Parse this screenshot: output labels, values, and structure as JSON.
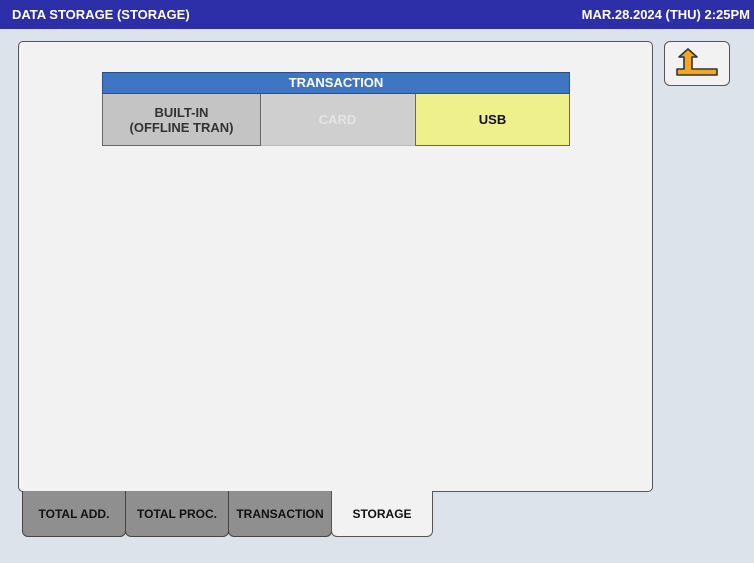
{
  "header": {
    "title": "DATA STORAGE (STORAGE)",
    "datetime": "MAR.28.2024 (THU)  2:25PM"
  },
  "back_button": {
    "icon": "return-arrow-icon"
  },
  "transaction_grid": {
    "header": "TRANSACTION",
    "options": {
      "builtin_line1": "BUILT-IN",
      "builtin_line2": "(OFFLINE TRAN)",
      "card": "CARD",
      "usb": "USB"
    },
    "selected": "USB",
    "colors": {
      "selected": "#eef08c",
      "header": "#3f76c4",
      "disabled_text": "#e4e4e4"
    }
  },
  "tabs": {
    "total_add": "TOTAL ADD.",
    "total_proc": "TOTAL PROC.",
    "transaction": "TRANSACTION",
    "storage": "STORAGE",
    "active": "STORAGE"
  }
}
